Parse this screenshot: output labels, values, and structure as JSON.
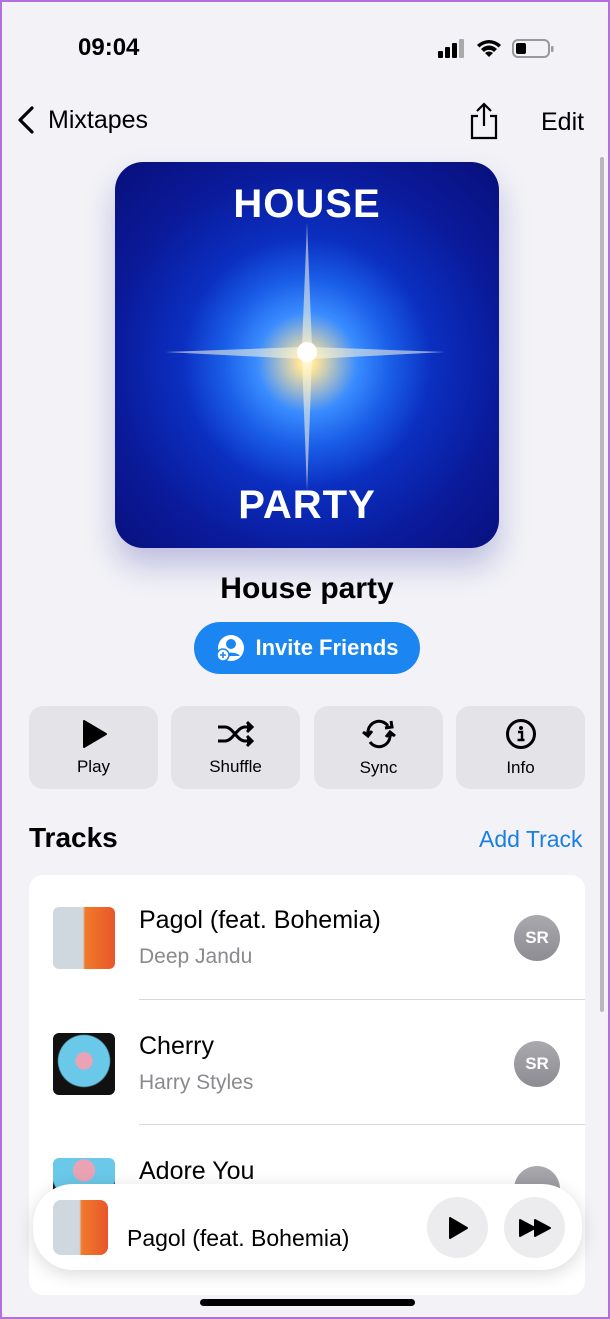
{
  "status_bar": {
    "time": "09:04"
  },
  "nav": {
    "back_label": "Mixtapes",
    "edit_label": "Edit"
  },
  "artwork": {
    "top_text": "HOUSE",
    "bottom_text": "PARTY"
  },
  "playlist": {
    "title": "House party",
    "invite_label": "Invite Friends"
  },
  "actions": [
    {
      "label": "Play",
      "icon": "play-icon"
    },
    {
      "label": "Shuffle",
      "icon": "shuffle-icon"
    },
    {
      "label": "Sync",
      "icon": "sync-icon"
    },
    {
      "label": "Info",
      "icon": "info-icon"
    }
  ],
  "tracks": {
    "header": "Tracks",
    "add_label": "Add Track",
    "items": [
      {
        "title": "Pagol (feat. Bohemia)",
        "artist": "Deep Jandu",
        "added_by": "SR"
      },
      {
        "title": "Cherry",
        "artist": "Harry Styles",
        "added_by": "SR"
      },
      {
        "title": "Adore You",
        "artist": "",
        "added_by": ""
      }
    ]
  },
  "mini_player": {
    "title": "Pagol (feat. Bohemia)"
  },
  "colors": {
    "accent": "#1b86f2",
    "background": "#f2f2f7"
  }
}
